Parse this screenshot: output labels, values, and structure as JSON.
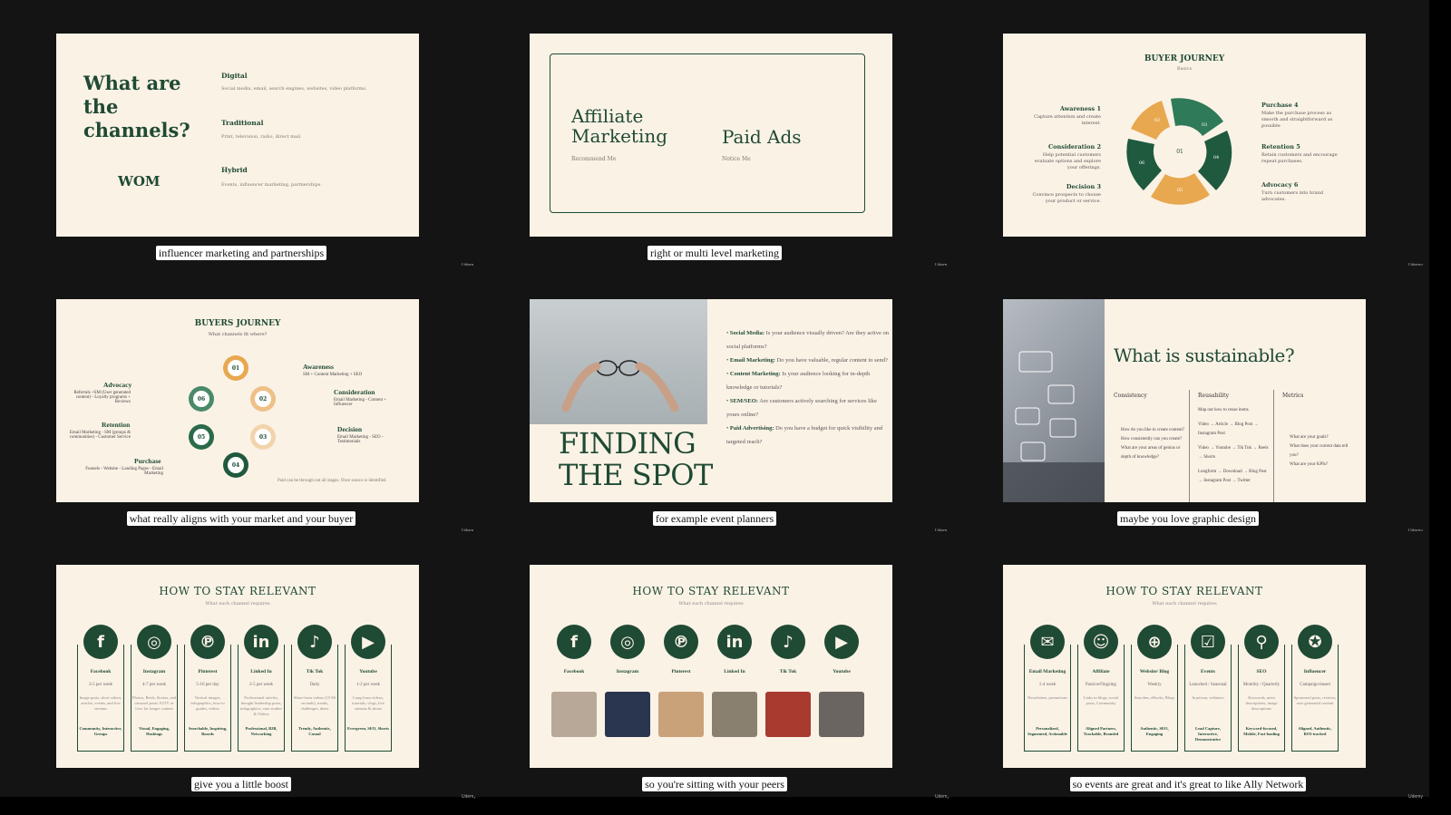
{
  "watermark": "Udemy",
  "cells": [
    {
      "caption": "influencer marketing and partnerships",
      "title": "What are the channels?",
      "wom": "WOM",
      "categories": [
        {
          "name": "Digital",
          "desc": "Social media, email, search engines, websites, video platforms."
        },
        {
          "name": "Traditional",
          "desc": "Print, television, radio, direct mail."
        },
        {
          "name": "Hybrid",
          "desc": "Events, influencer marketing, partnerships."
        }
      ]
    },
    {
      "caption": "right or multi level marketing",
      "left_title": "Affiliate Marketing",
      "left_sub": "Recommend Me",
      "right_title": "Paid Ads",
      "right_sub": "Notice Me"
    },
    {
      "caption": "",
      "title": "BUYER JOURNEY",
      "sub": "Basics",
      "colors": {
        "orange": "#e8a850",
        "green": "#2f7a58",
        "dark": "#1f5a3e"
      },
      "stages_left": [
        {
          "name": "Awareness 1",
          "desc": "Capture attention and create interest."
        },
        {
          "name": "Consideration 2",
          "desc": "Help potential customers evaluate options and explore your offerings."
        },
        {
          "name": "Decision 3",
          "desc": "Convince prospects to choose your product or service."
        }
      ],
      "stages_right": [
        {
          "name": "Purchase 4",
          "desc": "Make the purchase process as smooth and straightforward as possible"
        },
        {
          "name": "Retention 5",
          "desc": "Retain customers and encourage repeat purchases."
        },
        {
          "name": "Advocacy 6",
          "desc": "Turn customers into brand advocates."
        }
      ],
      "segments": [
        "01",
        "02",
        "03",
        "04",
        "05",
        "06"
      ]
    },
    {
      "caption": "what really aligns with your market and your buyer",
      "title": "BUYERS JOURNEY",
      "sub": "What channels fit where?",
      "nodes": [
        "01",
        "02",
        "03",
        "04",
        "05",
        "06"
      ],
      "right_items": [
        {
          "name": "Awareness",
          "desc": "SM + Content Marketing + SEO"
        },
        {
          "name": "Consideration",
          "desc": "Email Marketing - Content + Influencer"
        },
        {
          "name": "Decision",
          "desc": "Email Marketing - SEO - Testimonials"
        }
      ],
      "left_items": [
        {
          "name": "Advocacy",
          "desc": "Referrals +SM (User generated content) - Loyalty programs + Reviews"
        },
        {
          "name": "Retention",
          "desc": "Email Marketing - SM (groups & communities) - Customer Service"
        },
        {
          "name": "Purchase",
          "desc": "Funnels - Website - Landing Pages - Email Marketing"
        }
      ],
      "footnote": "Paid can be through out all stages. Once source is identified"
    },
    {
      "caption": "for example event planners",
      "title_line1": "FINDING",
      "title_line2": "THE SPOT",
      "bullets": [
        {
          "label": "Social Media:",
          "text": "Is your audience visually driven? Are they active on social platforms?"
        },
        {
          "label": "Email Marketing:",
          "text": "Do you have valuable, regular content to send?"
        },
        {
          "label": "Content Marketing:",
          "text": "Is your audience looking for in-depth knowledge or tutorials?"
        },
        {
          "label": "SEM/SEO:",
          "text": "Are customers actively searching for services like yours online?"
        },
        {
          "label": "Paid Advertising:",
          "text": "Do you have a budget for quick visibility and targeted reach?"
        }
      ]
    },
    {
      "caption": "maybe you love graphic design",
      "title": "What is sustainable?",
      "columns": [
        {
          "head": "Consistency",
          "lines": [
            "How do you like to create content?",
            "How consistently can you create?",
            "What are your areas of genius or depth of knowledge?"
          ]
        },
        {
          "head": "Reusability",
          "lines": [
            "Map out how to reuse items",
            "Video → Article → Blog Post → Instagram Post",
            "Video → Youtube → Tik Tok → Reels → Shorts",
            "Longform → Download → Blog Post → Instagram Post → Twitter"
          ]
        },
        {
          "head": "Metrics",
          "lines": [
            "What are your goals?",
            "What does your current data tell you?",
            "What are your KPIs?"
          ]
        }
      ]
    },
    {
      "caption": "give you a little boost",
      "title": "HOW TO STAY RELEVANT",
      "sub": "What each channel requires",
      "channels": [
        {
          "icon": "f",
          "name": "Facebook",
          "freq": "3-5 per week",
          "desc": "Image posts, short videos, articles, events, and live streams",
          "tags": "Community, Interactive, Groups"
        },
        {
          "icon": "◎",
          "name": "Instagram",
          "freq": "4-7 per week",
          "desc": "Photos, Reels, Stories, and carousel posts. IGTV or Live for longer content",
          "tags": "Visual, Engaging, Hashtags"
        },
        {
          "icon": "℗",
          "name": "Pinterest",
          "freq": "5-10 per day",
          "desc": "Vertical images, infographics, how-to guides, videos",
          "tags": "Searchable, Inspiring, Boards"
        },
        {
          "icon": "in",
          "name": "Linked In",
          "freq": "2-5 per week",
          "desc": "Professional articles, thought leadership posts, infographics, case studies & Videos",
          "tags": "Professional, B2B, Networking"
        },
        {
          "icon": "♪",
          "name": "Tik Tok",
          "freq": "Daily",
          "desc": "Short-form videos (15-60 seconds), trends, challenges, duets",
          "tags": "Trendy, Authentic, Casual"
        },
        {
          "icon": "▶",
          "name": "Youtube",
          "freq": "1-2 per week",
          "desc": "Long-form videos, tutorials, vlogs, live streams & shorts",
          "tags": "Evergreen, SEO, Shorts"
        }
      ]
    },
    {
      "caption": "so you're sitting with your peers",
      "title": "HOW TO STAY RELEVANT",
      "sub": "What each channel requires",
      "channels": [
        {
          "icon": "f",
          "name": "Facebook"
        },
        {
          "icon": "◎",
          "name": "Instagram"
        },
        {
          "icon": "℗",
          "name": "Pinterest"
        },
        {
          "icon": "in",
          "name": "Linked In"
        },
        {
          "icon": "♪",
          "name": "Tik Tok"
        },
        {
          "icon": "▶",
          "name": "Youtube"
        }
      ],
      "thumb_colors": [
        "#b8a898",
        "#2a3550",
        "#c9a27a",
        "#8a8070",
        "#a83a30",
        "#6a6560"
      ]
    },
    {
      "caption": "so events are great and it's great to like Ally Network",
      "title": "HOW TO STAY RELEVANT",
      "sub": "What each channel requires",
      "channels": [
        {
          "icon": "✉",
          "name": "Email Marketing",
          "freq": "1-4 week",
          "desc": "Newsletters, promotions",
          "tags": "Personalized, Segmented, Actionable"
        },
        {
          "icon": "☺",
          "name": "Affiliate",
          "freq": "Passive/Ongoing",
          "desc": "Links in blogs, social posts, Community",
          "tags": "Aligned Partners, Trackable, Branded"
        },
        {
          "icon": "⊕",
          "name": "Website/ Blog",
          "freq": "Weekly",
          "desc": "Searches, eBooks, Blogs",
          "tags": "Authentic, SEO, Engaging"
        },
        {
          "icon": "☑",
          "name": "Events",
          "freq": "Launched / Seasonal",
          "desc": "In person, webinars",
          "tags": "Lead Capture, Interactive, Demonstrative"
        },
        {
          "icon": "⚲",
          "name": "SEO",
          "freq": "Monthly / Quarterly",
          "desc": "Keywords, meta descriptions, image descriptions",
          "tags": "Keyword-focused, Mobile, Fast-loading"
        },
        {
          "icon": "✪",
          "name": "Influencer",
          "freq": "Campaign-based",
          "desc": "Sponsored posts, reviews, user generated content",
          "tags": "Aligned, Authentic, ROI-tracked"
        }
      ]
    }
  ]
}
